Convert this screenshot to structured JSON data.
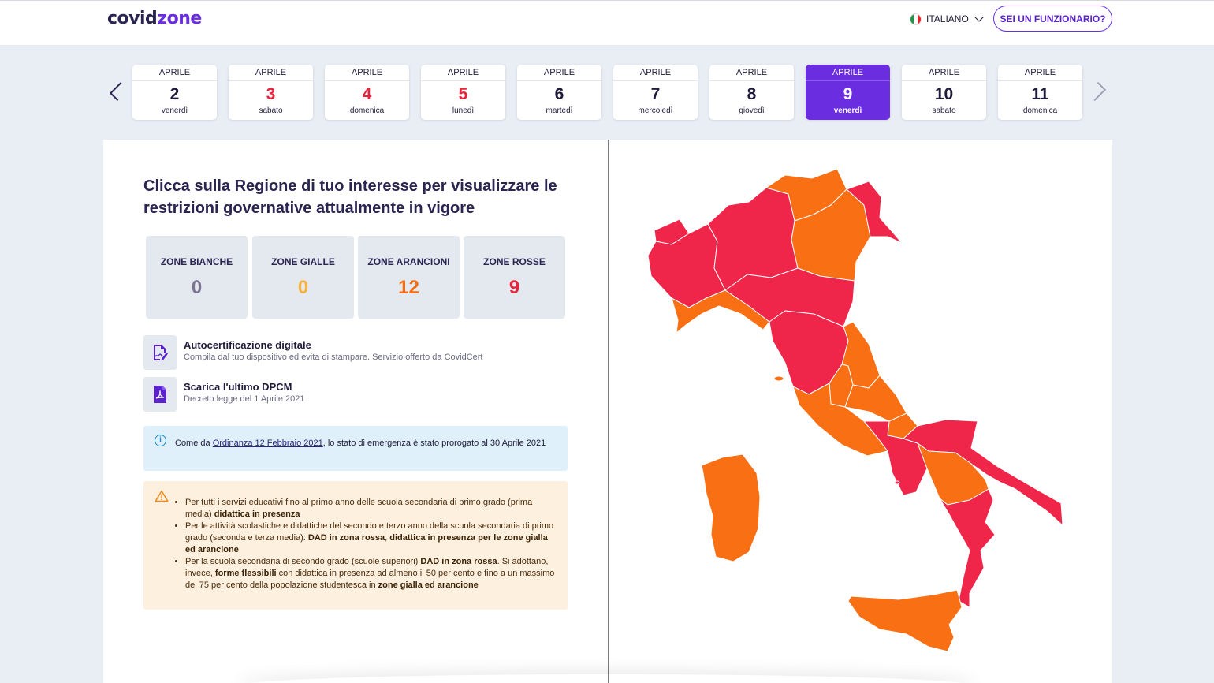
{
  "header": {
    "logo_part1": "covid",
    "logo_part2": "zone",
    "language": "ITALIANO",
    "official_button": "SEI UN FUNZIONARIO?"
  },
  "days": [
    {
      "month": "APRILE",
      "day": "2",
      "weekday": "venerdì",
      "red": false,
      "active": false
    },
    {
      "month": "APRILE",
      "day": "3",
      "weekday": "sabato",
      "red": true,
      "active": false
    },
    {
      "month": "APRILE",
      "day": "4",
      "weekday": "domenica",
      "red": true,
      "active": false
    },
    {
      "month": "APRILE",
      "day": "5",
      "weekday": "lunedì",
      "red": true,
      "active": false
    },
    {
      "month": "APRILE",
      "day": "6",
      "weekday": "martedì",
      "red": false,
      "active": false
    },
    {
      "month": "APRILE",
      "day": "7",
      "weekday": "mercoledì",
      "red": false,
      "active": false
    },
    {
      "month": "APRILE",
      "day": "8",
      "weekday": "giovedì",
      "red": false,
      "active": false
    },
    {
      "month": "APRILE",
      "day": "9",
      "weekday": "venerdì",
      "red": false,
      "active": true
    },
    {
      "month": "APRILE",
      "day": "10",
      "weekday": "sabato",
      "red": false,
      "active": false
    },
    {
      "month": "APRILE",
      "day": "11",
      "weekday": "domenica",
      "red": false,
      "active": false
    }
  ],
  "main": {
    "title": "Clicca sulla Regione di tuo interesse per visualizzare le restrizioni governative attualmente in vigore"
  },
  "stats": [
    {
      "label": "ZONE BIANCHE",
      "value": "0",
      "color": "#7a7490"
    },
    {
      "label": "ZONE GIALLE",
      "value": "0",
      "color": "#f7b23b"
    },
    {
      "label": "ZONE ARANCIONI",
      "value": "12",
      "color": "#f26d16"
    },
    {
      "label": "ZONE ROSSE",
      "value": "9",
      "color": "#e8243c"
    }
  ],
  "links": {
    "autocert_title": "Autocertificazione digitale",
    "autocert_sub": "Compila dal tuo dispositivo ed evita di stampare. Servizio offerto da CovidCert",
    "dpcm_title": "Scarica l'ultimo DPCM",
    "dpcm_sub": "Decreto legge del 1 Aprile 2021"
  },
  "info": {
    "prefix": "Come da ",
    "link": "Ordinanza 12 Febbraio 2021",
    "suffix": ", lo stato di emergenza è stato prorogato al 30 Aprile 2021"
  },
  "warning": {
    "items": [
      [
        {
          "t": "Per tutti i servizi educativi fino al primo anno delle scuola secondaria di primo grado (prima media) ",
          "b": false
        },
        {
          "t": "didattica in presenza",
          "b": true
        }
      ],
      [
        {
          "t": "Per le attività scolastiche e didattiche del secondo e terzo anno della scuola secondaria di primo grado (seconda e terza media): ",
          "b": false
        },
        {
          "t": "DAD in zona rossa",
          "b": true
        },
        {
          "t": ", ",
          "b": false
        },
        {
          "t": "didattica in presenza per le zone gialla ed arancione",
          "b": true
        }
      ],
      [
        {
          "t": "Per la scuola secondaria di secondo grado (scuole superiori) ",
          "b": false
        },
        {
          "t": "DAD in zona rossa",
          "b": true
        },
        {
          "t": ". Si adottano, invece, ",
          "b": false
        },
        {
          "t": "forme flessibili",
          "b": true
        },
        {
          "t": " con didattica in presenza ad almeno il 50 per cento e fino a un massimo del 75 per cento della popolazione studentesca in ",
          "b": false
        },
        {
          "t": "zone gialla ed arancione",
          "b": true
        }
      ]
    ]
  },
  "map_colors": {
    "red": "#f0254a",
    "orange": "#f86f14"
  },
  "accent": "#6a2ee0"
}
